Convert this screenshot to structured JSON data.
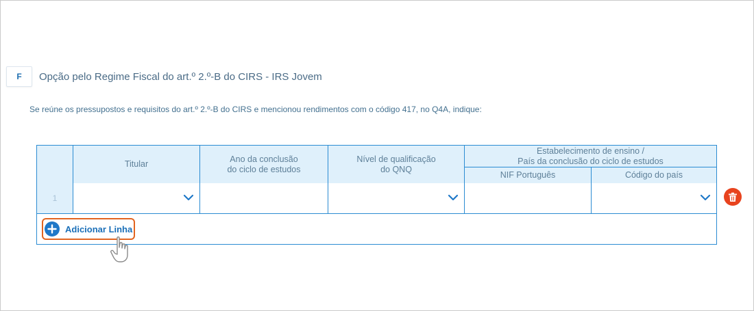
{
  "section": {
    "letter": "F",
    "title": "Opção pelo Regime Fiscal do art.º 2.º-B do CIRS - IRS Jovem"
  },
  "intro_text": "Se reúne os pressupostos e requisitos do art.º 2.º-B do CIRS e mencionou rendimentos com o código 417, no Q4A, indique:",
  "table": {
    "headers": {
      "titular": "Titular",
      "ano_line1": "Ano da conclusão",
      "ano_line2": "do ciclo de estudos",
      "nivel_line1": "Nível de qualificação",
      "nivel_line2": "do QNQ",
      "estab_line1": "Estabelecimento de ensino /",
      "estab_line2": "País da conclusão do ciclo de estudos",
      "nif": "NIF Português",
      "codigo_pais": "Código do país"
    },
    "rows": [
      {
        "number": "1",
        "titular": "",
        "ano": "",
        "nivel": "",
        "nif": "",
        "codigo_pais": ""
      }
    ]
  },
  "actions": {
    "add_row_label": "Adicionar Linha",
    "delete_icon": "trash-icon",
    "add_icon": "plus-circle-icon"
  },
  "colors": {
    "accent": "#2a8bd2",
    "header_bg": "#dff0fb",
    "highlight": "#e2641f",
    "delete": "#e8431e"
  }
}
